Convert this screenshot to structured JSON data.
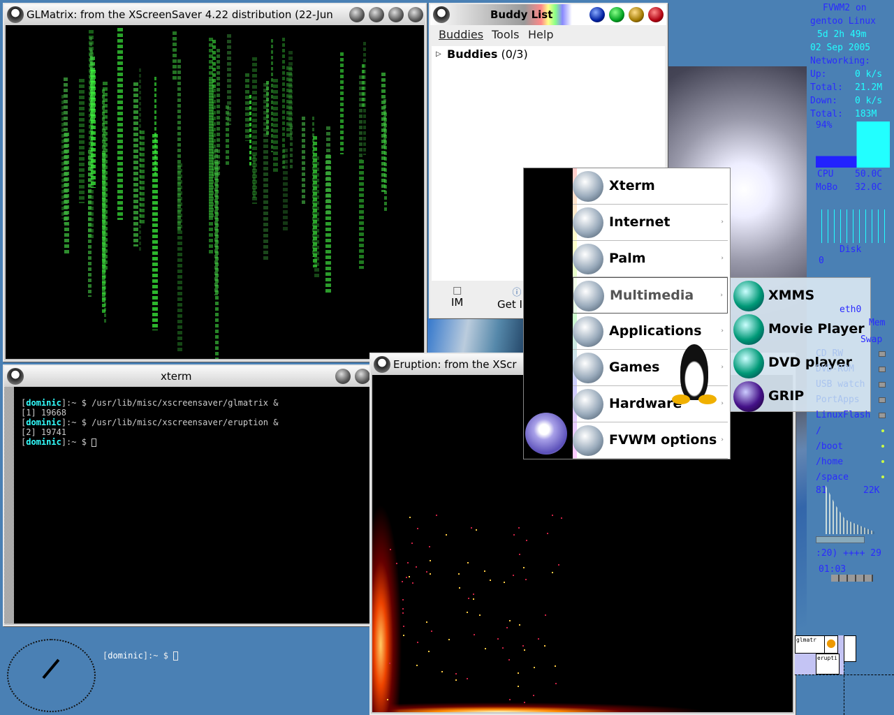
{
  "glmatrix": {
    "title": "GLMatrix:  from the XScreenSaver 4.22 distribution (22-Jun"
  },
  "buddy_list": {
    "title": "Buddy List",
    "menu": [
      "Buddies",
      "Tools",
      "Help"
    ],
    "group": "Buddies",
    "group_count": "(0/3)",
    "buttons": [
      {
        "label": "IM",
        "icon": "im-icon"
      },
      {
        "label": "Get I",
        "icon": "info-icon"
      }
    ],
    "title_buttons": [
      "#0020a0",
      "#00a020",
      "#a07800",
      "#b00010"
    ]
  },
  "xterm": {
    "title": "xterm",
    "lines": [
      {
        "user": "dominic",
        "prompt": ":~ $ ",
        "cmd": "/usr/lib/misc/xscreensaver/glmatrix &"
      },
      {
        "out": "[1] 19668"
      },
      {
        "out": ""
      },
      {
        "user": "dominic",
        "prompt": ":~ $ ",
        "cmd": "/usr/lib/misc/xscreensaver/eruption &"
      },
      {
        "out": "[2] 19741"
      },
      {
        "out": ""
      },
      {
        "user": "dominic",
        "prompt": ":~ $ ",
        "cmd": ""
      }
    ]
  },
  "eruption": {
    "title": "Eruption:  from the XScr"
  },
  "menu": {
    "items": [
      {
        "label": "Xterm",
        "icon": "xterm-icon"
      },
      {
        "label": "Internet",
        "icon": "internet-icon"
      },
      {
        "label": "Palm",
        "icon": "palm-icon"
      },
      {
        "label": "Multimedia",
        "icon": "multimedia-icon",
        "selected": true
      },
      {
        "label": "Applications",
        "icon": "applications-icon"
      },
      {
        "label": "Games",
        "icon": "games-icon"
      },
      {
        "label": "Hardware",
        "icon": "hardware-icon"
      },
      {
        "label": "FVWM options",
        "icon": "fvwm-icon"
      }
    ],
    "submenu": [
      {
        "label": "XMMS",
        "icon": "xmms-icon"
      },
      {
        "label": "Movie Player",
        "icon": "movie-player-icon"
      },
      {
        "label": "DVD player",
        "icon": "dvd-player-icon"
      },
      {
        "label": "GRIP",
        "icon": "grip-icon"
      }
    ]
  },
  "sysinfo": {
    "line1": "FVWM2 on",
    "line2": "gentoo Linux",
    "uptime": "5d 2h 49m",
    "date": "02 Sep 2005",
    "net_label": "Networking:",
    "up_label": "Up:",
    "up_val": "0 k/s",
    "total1_label": "Total:",
    "total1_val": "21.2M",
    "down_label": "Down:",
    "down_val": "0 k/s",
    "total2_label": "Total:",
    "total2_val": "183M",
    "cpu_pct": "94%",
    "cpu_label": "CPU",
    "cpu_temp": "50.0C",
    "mobo_label": "MoBo",
    "mobo_temp": "32.0C",
    "disk_label": "Disk",
    "disk_zero": "0",
    "eth_label": "eth0",
    "mem_label": "Mem",
    "swap_label": "Swap",
    "mounts": [
      "CD RW",
      "DVD-ROM",
      "USB watch",
      "PortApps",
      "LinuxFlash"
    ],
    "fs": [
      "/",
      "/boot",
      "/home",
      "/space"
    ],
    "spec_left": "81",
    "spec_right": "22K",
    "xmms_title": ":20) ++++ 29",
    "xmms_time": "01:03"
  },
  "desktop_prompt": {
    "user": "dominic",
    "prompt": ":~ $ "
  },
  "pager": {
    "windows": [
      "glmatr",
      "erupti"
    ]
  }
}
